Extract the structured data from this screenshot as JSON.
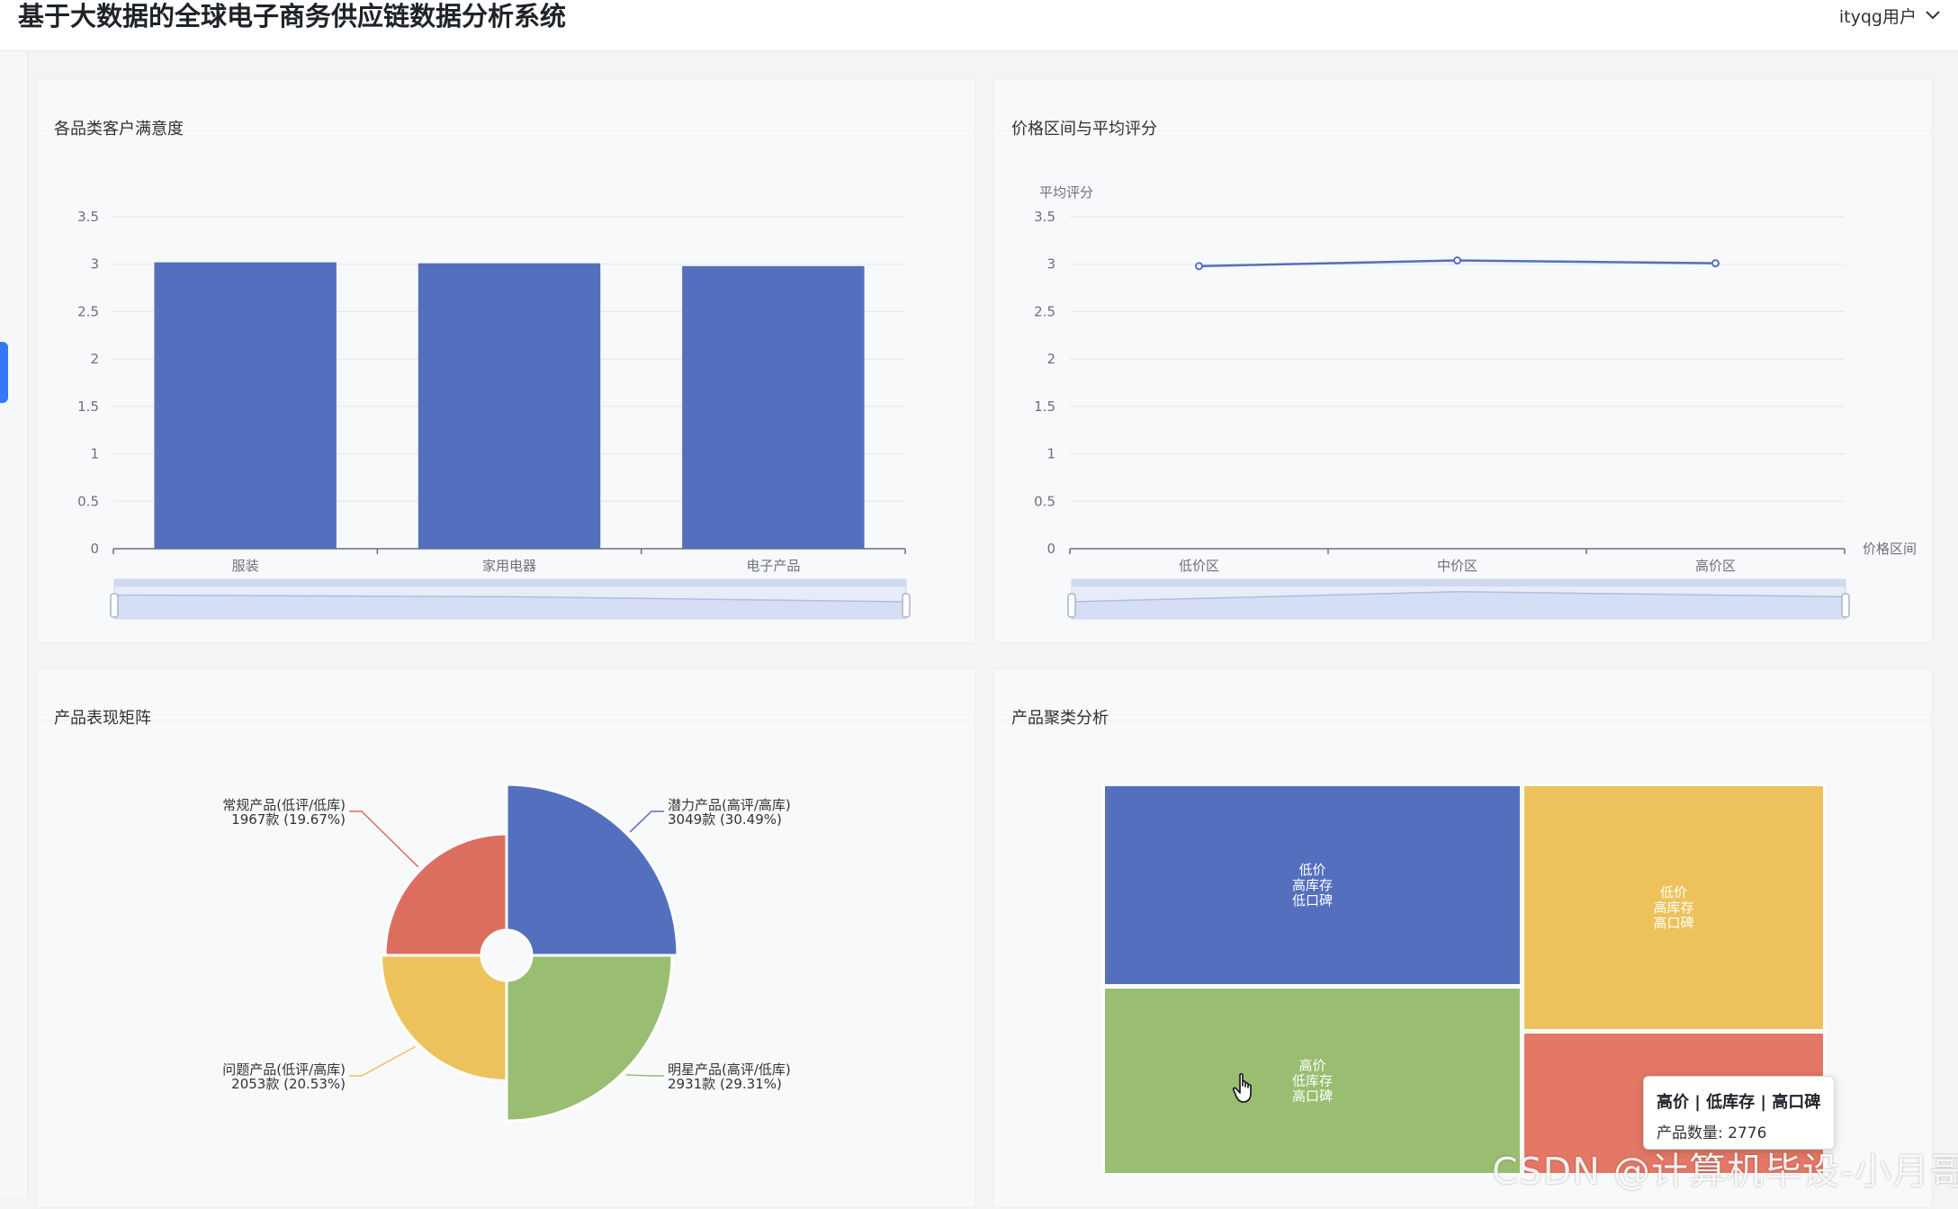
{
  "app": {
    "title": "基于大数据的全球电子商务供应链数据分析系统",
    "user_label": "ityqg用户"
  },
  "panels": {
    "satisfaction": {
      "title": "各品类客户满意度"
    },
    "price_rating": {
      "title": "价格区间与平均评分"
    },
    "matrix": {
      "title": "产品表现矩阵"
    },
    "cluster": {
      "title": "产品聚类分析"
    }
  },
  "chart_data": [
    {
      "type": "bar",
      "categories": [
        "服装",
        "家用电器",
        "电子产品"
      ],
      "values": [
        3.02,
        3.01,
        2.98
      ],
      "ylim": [
        0,
        3.5
      ],
      "yticks": [
        "0",
        "0.5",
        "1",
        "1.5",
        "2",
        "2.5",
        "3",
        "3.5"
      ],
      "color": "#546fbd"
    },
    {
      "type": "line",
      "categories": [
        "低价区",
        "中价区",
        "高价区"
      ],
      "values": [
        2.98,
        3.04,
        3.01
      ],
      "ylim": [
        0,
        3.5
      ],
      "yticks": [
        "0",
        "0.5",
        "1",
        "1.5",
        "2",
        "2.5",
        "3",
        "3.5"
      ],
      "ylabel": "平均评分",
      "xlabel": "价格区间",
      "color": "#546fbd"
    },
    {
      "type": "pie",
      "slices": [
        {
          "name": "潜力产品(高评/高库)",
          "count_label": "3049款 (30.49%)",
          "value": 3049,
          "percent": 30.49,
          "color": "#546fbd"
        },
        {
          "name": "明星产品(高评/低库)",
          "count_label": "2931款 (29.31%)",
          "value": 2931,
          "percent": 29.31,
          "color": "#99bd71"
        },
        {
          "name": "问题产品(低评/高库)",
          "count_label": "2053款 (20.53%)",
          "value": 2053,
          "percent": 20.53,
          "color": "#edc25c"
        },
        {
          "name": "常规产品(低评/低库)",
          "count_label": "1967款 (19.67%)",
          "value": 1967,
          "percent": 19.67,
          "color": "#dc6e5f"
        }
      ]
    },
    {
      "type": "treemap",
      "cells": [
        {
          "lines": [
            "低价",
            "高库存",
            "低口碑"
          ],
          "color": "#546fbd"
        },
        {
          "lines": [
            "低价",
            "高库存",
            "高口碑"
          ],
          "color": "#edc25c"
        },
        {
          "lines": [
            "高价",
            "低库存",
            "高口碑"
          ],
          "color": "#99bd71"
        },
        {
          "lines": [],
          "color": "#e47766"
        }
      ]
    }
  ],
  "tooltip": {
    "title": "高价 | 低库存 | 高口碑",
    "value": "产品数量: 2776"
  },
  "watermark": "CSDN @计算机毕设-小月哥"
}
